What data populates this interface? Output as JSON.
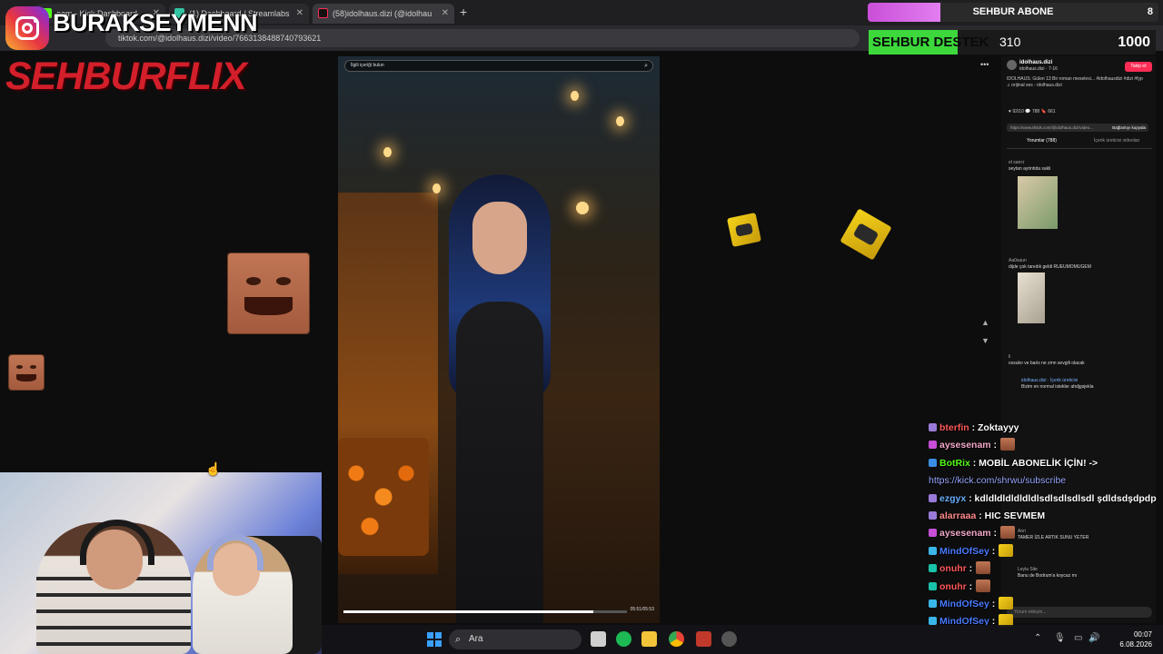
{
  "browser": {
    "tabs": [
      {
        "label": "eam - Kick Dashboard"
      },
      {
        "label": "(1) Dashboard / Streamlabs"
      },
      {
        "label": "(58)idolhaus.dizi (@idolhau"
      }
    ],
    "new_tab": "+",
    "url": "tiktok.com/@idolhaus.dizi/video/7663138488740793621"
  },
  "overlay": {
    "instagram_handle": "BURAKSEYMENN",
    "brand": "SEHBURFLIX",
    "sub_goal": {
      "label": "SEHBUR ABONE",
      "value": "8",
      "progress": 0.25
    },
    "donation_goal": {
      "label": "SEHBUR DESTEK",
      "current": "310",
      "target": "1000",
      "progress": 0.31
    }
  },
  "video": {
    "search_placeholder": "İlgili içeriği bulun",
    "time": "05:51/05:53",
    "progress": 0.88
  },
  "tiktok_panel": {
    "author": "idolhaus.dizi",
    "author_sub": "idolhaus.dizi · 7-16",
    "follow": "Takip et",
    "caption": "IDOLHAUS: Gülen 13 Bir roman meselesi... #idolhausdizi #dizi #fyp",
    "sound": "♫ orijinal ses - idolhaus.dizi",
    "stats": "♥ 92/10   💬 788   🔖 661",
    "link": "https://www.tiktok.com/@idolhaus.dizi/video...",
    "copy_link": "Bağlantıyı kopyala",
    "tab_comments": "Yorumlar (788)",
    "tab_videos": "İçerik üreticisi videoları",
    "comments": [
      {
        "user": "el sancr",
        "text": "seytan ayrintida sakli"
      },
      {
        "user": "Aa0saun",
        "text": "dijde çok tanıdık geldi RUEUMOMUGEM"
      },
      {
        "user": "li",
        "text": "cesuko ve baris ne zmn sevgili olacak"
      },
      {
        "user": "idolhaus.dizi · İçerik üreticisi",
        "text": "Bizim en normal istekler ahdjgsjekla"
      },
      {
        "user": "Anri",
        "text": "TAMER İZLE ARTIK SUNU YETER"
      },
      {
        "user": "Leyla Site",
        "text": "Banu de Bodrum'a koycaz mı"
      }
    ],
    "input_placeholder": "Yorum ekleyin..."
  },
  "chat": [
    {
      "user": "bterfin",
      "color": "#ff5a5a",
      "text": ": Zoktayyy",
      "badge": "#9a7ad8"
    },
    {
      "user": "aysesenam",
      "color": "#f2a8c8",
      "text": " :",
      "badge": "#c64fd6",
      "emote": "laugh"
    },
    {
      "user": "BotRix",
      "color": "#53fc18",
      "text": ": MOBİL ABONELİK İÇİN! ->",
      "badge": "#3a8ee6"
    },
    {
      "user": "",
      "color": "#9aa8ff",
      "text": "https://kick.com/shrwu/subscribe",
      "link": true
    },
    {
      "user": "ezgyx",
      "color": "#6ab0ff",
      "text": ": kdldldldldldldlsdlsdlsdlsdl şdldsdşdpdp",
      "badge": "#9a7ad8"
    },
    {
      "user": "alarraaa",
      "color": "#ff8a8a",
      "text": ": HIC SEVMEM",
      "badge": "#9a7ad8"
    },
    {
      "user": "aysesenam",
      "color": "#f2a8c8",
      "text": " :",
      "badge": "#c64fd6",
      "emote": "laugh"
    },
    {
      "user": "MindOfSey",
      "color": "#4a7aff",
      "text": " :",
      "badge": "#3ab6e8",
      "emote": "gold"
    },
    {
      "user": "onuhr",
      "color": "#ff5a5a",
      "text": " :",
      "badge": "#19c2a8",
      "emote": "laugh"
    },
    {
      "user": "onuhr",
      "color": "#ff5a5a",
      "text": " :",
      "badge": "#19c2a8",
      "emote": "laugh"
    },
    {
      "user": "MindOfSey",
      "color": "#4a7aff",
      "text": " :",
      "badge": "#3ab6e8",
      "emote": "gold"
    },
    {
      "user": "MindOfSey",
      "color": "#4a7aff",
      "text": " :",
      "badge": "#3ab6e8",
      "emote": "gold"
    }
  ],
  "taskbar": {
    "search_label": "Ara",
    "time": "00:07",
    "date": "6.08.2026"
  },
  "colors": {
    "brand_red": "#d21f2a",
    "donation_green": "#3cd83c",
    "sub_purple": "#c94fd8",
    "tiktok_red": "#fe2c55"
  }
}
